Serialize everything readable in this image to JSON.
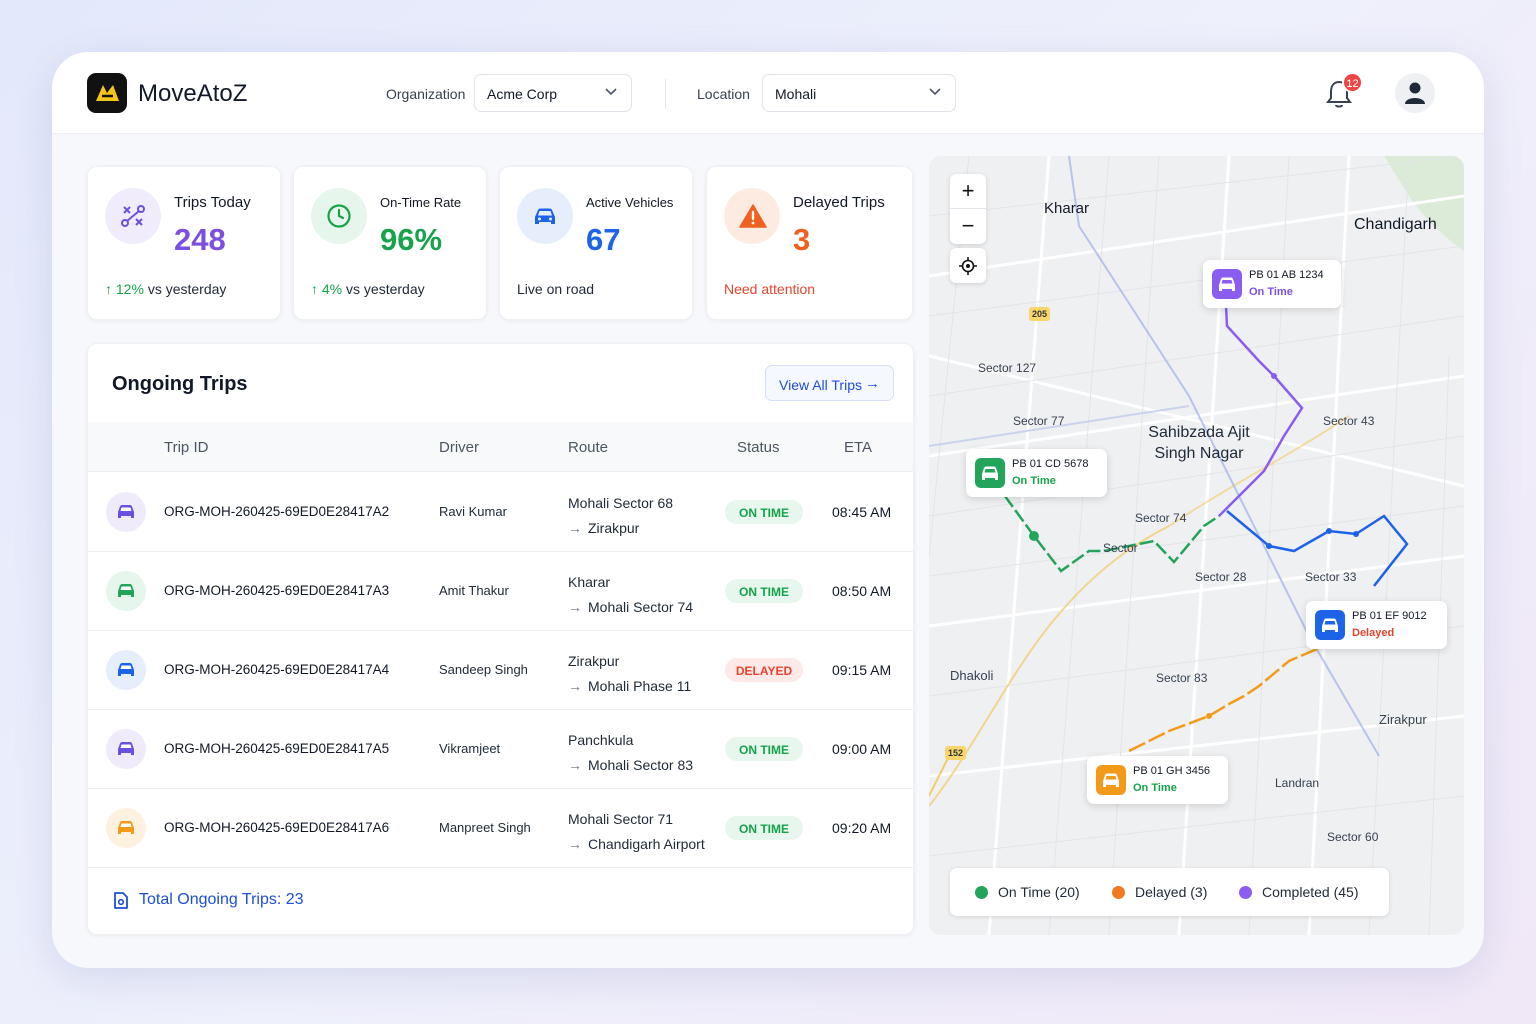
{
  "app": {
    "name": "MoveAtoZ"
  },
  "header": {
    "organization_label": "Organization",
    "organization_value": "Acme Corp",
    "location_label": "Location",
    "location_value": "Mohali",
    "notification_count": "12"
  },
  "kpis": [
    {
      "title": "Trips Today",
      "value": "248",
      "delta": "12%",
      "sub": "vs yesterday",
      "color": "#7c4fe0",
      "icon": "route-icon"
    },
    {
      "title": "On-Time Rate",
      "value": "96%",
      "delta": "4%",
      "sub": "vs yesterday",
      "color": "#16a34a",
      "icon": "clock-icon"
    },
    {
      "title": "Active Vehicles",
      "value": "67",
      "sub": "Live on road",
      "color": "#1d63e8",
      "icon": "car-icon"
    },
    {
      "title": "Delayed Trips",
      "value": "3",
      "sub": "Need attention",
      "color": "#f0601f",
      "icon": "warning-icon"
    }
  ],
  "trips": {
    "title": "Ongoing Trips",
    "view_all": "View All Trips",
    "columns": [
      "Trip ID",
      "Driver",
      "Route",
      "Status",
      "ETA"
    ],
    "rows": [
      {
        "id": "ORG-MOH-260425-69ED0E28417A2",
        "driver": "Ravi Kumar",
        "from": "Mohali Sector 68",
        "to": "Zirakpur",
        "status": "ON TIME",
        "eta": "08:45 AM",
        "icon_color": "#6b4fe0",
        "icon_bg": "#efebfb"
      },
      {
        "id": "ORG-MOH-260425-69ED0E28417A3",
        "driver": "Amit Thakur",
        "from": "Kharar",
        "to": "Mohali Sector 74",
        "status": "ON TIME",
        "eta": "08:50 AM",
        "icon_color": "#22a55a",
        "icon_bg": "#e7f6ec"
      },
      {
        "id": "ORG-MOH-260425-69ED0E28417A4",
        "driver": "Sandeep Singh",
        "from": "Zirakpur",
        "to": "Mohali Phase 11",
        "status": "DELAYED",
        "eta": "09:15 AM",
        "icon_color": "#1d63e8",
        "icon_bg": "#e6eefc"
      },
      {
        "id": "ORG-MOH-260425-69ED0E28417A5",
        "driver": "Vikramjeet",
        "from": "Panchkula",
        "to": "Mohali Sector 83",
        "status": "ON TIME",
        "eta": "09:00 AM",
        "icon_color": "#6b4fe0",
        "icon_bg": "#efebfb"
      },
      {
        "id": "ORG-MOH-260425-69ED0E28417A6",
        "driver": "Manpreet Singh",
        "from": "Mohali Sector 71",
        "to": "Chandigarh Airport",
        "status": "ON TIME",
        "eta": "09:20 AM",
        "icon_color": "#f39a1a",
        "icon_bg": "#fdf1e0"
      }
    ],
    "total": "Total Ongoing Trips: 23"
  },
  "map": {
    "labels": {
      "kharar": "Kharar",
      "chandigarh": "Chandigarh",
      "sector127": "Sector 127",
      "sector77": "Sector 77",
      "sas_nagar": "Sahibzada Ajit Singh Nagar",
      "sector43": "Sector 43",
      "sector74": "Sector 74",
      "sector": "Sector",
      "sector28": "Sector 28",
      "sector33": "Sector 33",
      "dhakoli": "Dhakoli",
      "sector83": "Sector 83",
      "zirakpur": "Zirakpur",
      "landran": "Landran",
      "sector60": "Sector 60",
      "hw205": "205",
      "hw152": "152"
    },
    "vehicles": [
      {
        "plate": "PB 01 AB 1234",
        "status": "On Time",
        "color": "#8a5cf0",
        "status_color": "#7c4fe0"
      },
      {
        "plate": "PB 01 CD 5678",
        "status": "On Time",
        "color": "#22a55a",
        "status_color": "#16a34a"
      },
      {
        "plate": "PB 01 EF 9012",
        "status": "Delayed",
        "color": "#1d63e8",
        "status_color": "#e4452c"
      },
      {
        "plate": "PB 01 GH 3456",
        "status": "On Time",
        "color": "#f39a1a",
        "status_color": "#16a34a"
      }
    ],
    "legend": [
      {
        "label": "On Time (20)",
        "color": "#22a55a"
      },
      {
        "label": "Delayed (3)",
        "color": "#f07a22"
      },
      {
        "label": "Completed (45)",
        "color": "#8a5cf0"
      }
    ]
  }
}
